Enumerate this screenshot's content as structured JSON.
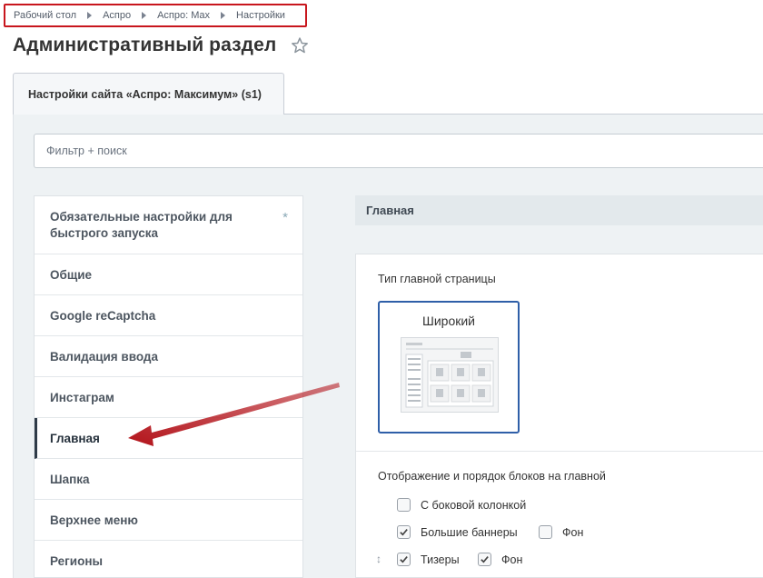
{
  "breadcrumb": [
    "Рабочий стол",
    "Аспро",
    "Аспро: Max",
    "Настройки"
  ],
  "page_title": "Административный раздел",
  "tab_label": "Настройки сайта «Аспро: Максимум» (s1)",
  "filter_placeholder": "Фильтр + поиск",
  "menu": [
    "Обязательные настройки для быстрого запуска",
    "Общие",
    "Google reCaptcha",
    "Валидация ввода",
    "Инстаграм",
    "Главная",
    "Шапка",
    "Верхнее меню",
    "Регионы"
  ],
  "active_menu_item": "Главная",
  "section_title": "Главная",
  "home_type_label": "Тип главной страницы",
  "home_type_selected": "Широкий",
  "blocks_label": "Отображение и порядок блоков на главной",
  "options": {
    "side_column": {
      "label": "С боковой колонкой",
      "checked": false
    },
    "big_banners": {
      "label": "Большие баннеры",
      "checked": true
    },
    "big_banners_bg": {
      "label": "Фон",
      "checked": false
    },
    "teasers": {
      "label": "Тизеры",
      "checked": true
    },
    "teasers_bg": {
      "label": "Фон",
      "checked": true
    }
  },
  "colors": {
    "highlight": "#c8161d",
    "card_border": "#2f5fa8",
    "panel_bg": "#eef2f4"
  }
}
